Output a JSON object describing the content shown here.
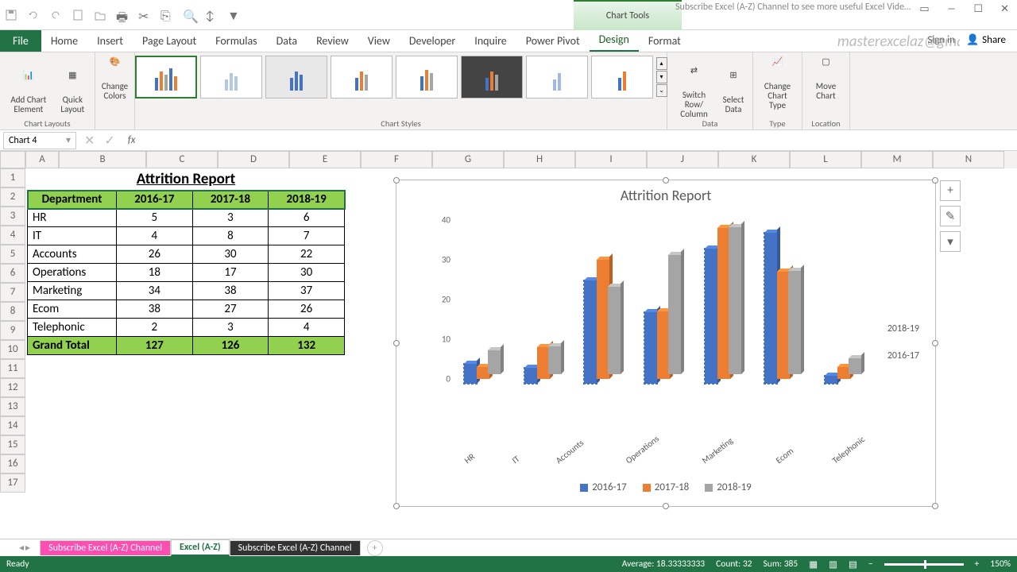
{
  "qat_hint": "Quick Access Toolbar",
  "title_banner": "Subscribe Excel (A-Z) Channel to see more useful Excel Vide…",
  "watermark": "masterexcelaz@gmail.com",
  "chart_tools_label": "Chart Tools",
  "tabs": {
    "file": "File",
    "home": "Home",
    "insert": "Insert",
    "pagelayout": "Page Layout",
    "formulas": "Formulas",
    "data": "Data",
    "review": "Review",
    "view": "View",
    "developer": "Developer",
    "inquire": "Inquire",
    "powerpivot": "Power Pivot",
    "design": "Design",
    "format": "Format"
  },
  "signin": "Sign in",
  "share": "Share",
  "ribbon": {
    "chart_layouts": "Chart Layouts",
    "add_element": "Add Chart Element",
    "quick_layout": "Quick Layout",
    "change_colors": "Change Colors",
    "chart_styles": "Chart Styles",
    "switch_rc": "Switch Row/ Column",
    "select_data": "Select Data",
    "data_group": "Data",
    "change_type": "Change Chart Type",
    "type_group": "Type",
    "move_chart": "Move Chart",
    "location_group": "Location"
  },
  "namebox": "Chart 4",
  "columns": [
    "A",
    "B",
    "C",
    "D",
    "E",
    "F",
    "G",
    "H",
    "I",
    "J",
    "K",
    "L",
    "M",
    "N"
  ],
  "table": {
    "title": "Attrition Report",
    "headers": [
      "Department",
      "2016-17",
      "2017-18",
      "2018-19"
    ],
    "rows": [
      [
        "HR",
        "5",
        "3",
        "6"
      ],
      [
        "IT",
        "4",
        "8",
        "7"
      ],
      [
        "Accounts",
        "26",
        "30",
        "22"
      ],
      [
        "Operations",
        "18",
        "17",
        "30"
      ],
      [
        "Marketing",
        "34",
        "38",
        "37"
      ],
      [
        "Ecom",
        "38",
        "27",
        "26"
      ],
      [
        "Telephonic",
        "2",
        "3",
        "4"
      ]
    ],
    "total": [
      "Grand Total",
      "127",
      "126",
      "132"
    ]
  },
  "chart_title": "Attrition Report",
  "y_ticks": [
    "0",
    "10",
    "20",
    "30",
    "40"
  ],
  "depth_labels": {
    "front": "2016-17",
    "back": "2018-19"
  },
  "legend": [
    "2016-17",
    "2017-18",
    "2018-19"
  ],
  "legend_colors": [
    "#4472C4",
    "#ED7D31",
    "#A5A5A5"
  ],
  "categories": [
    "HR",
    "IT",
    "Accounts",
    "Operations",
    "Marketing",
    "Ecom",
    "Telephonic"
  ],
  "sheets": {
    "s1": "Subscribe Excel (A-Z) Channel",
    "s2": "Excel (A-Z)",
    "s3": "Subscribe Excel (A-Z) Channel"
  },
  "status": {
    "ready": "Ready",
    "avg": "Average: 18.33333333",
    "count": "Count: 32",
    "sum": "Sum: 385",
    "zoom": "150%"
  },
  "side_btns": {
    "plus": "+",
    "brush": "✎",
    "filter": "▾"
  },
  "chart_data": {
    "type": "bar",
    "title": "Attrition Report",
    "categories": [
      "HR",
      "IT",
      "Accounts",
      "Operations",
      "Marketing",
      "Ecom",
      "Telephonic"
    ],
    "series": [
      {
        "name": "2016-17",
        "values": [
          5,
          4,
          26,
          18,
          34,
          38,
          2
        ]
      },
      {
        "name": "2017-18",
        "values": [
          3,
          8,
          30,
          17,
          38,
          27,
          3
        ]
      },
      {
        "name": "2018-19",
        "values": [
          6,
          7,
          22,
          30,
          37,
          26,
          4
        ]
      }
    ],
    "ylabel": "",
    "xlabel": "",
    "ylim": [
      0,
      40
    ],
    "style": "3-D Clustered Column",
    "legend_position": "bottom"
  }
}
